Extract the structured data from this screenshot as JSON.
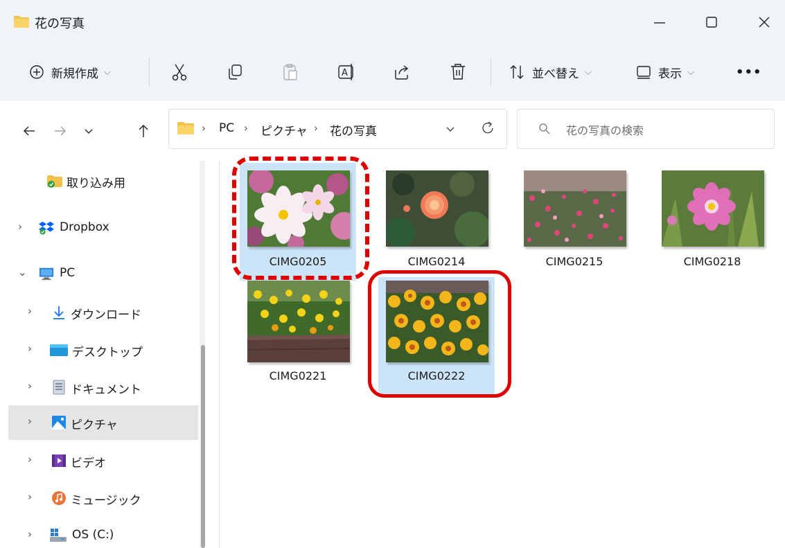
{
  "window": {
    "title": "花の写真",
    "controls": {
      "minimize": "minimize-icon",
      "maximize": "maximize-icon",
      "close": "close-icon"
    }
  },
  "toolbar": {
    "new_label": "新規作成",
    "sort_label": "並べ替え",
    "view_label": "表示",
    "more_label": "•••"
  },
  "address": {
    "crumbs": [
      "PC",
      "ピクチャ",
      "花の写真"
    ],
    "search_placeholder": "花の写真の検索"
  },
  "sidebar": {
    "items": [
      {
        "label": "取り込み用",
        "icon": "folder-sync-icon"
      },
      {
        "label": "Dropbox",
        "icon": "dropbox-icon"
      },
      {
        "label": "PC",
        "icon": "pc-icon"
      },
      {
        "label": "ダウンロード",
        "icon": "download-icon"
      },
      {
        "label": "デスクトップ",
        "icon": "desktop-icon"
      },
      {
        "label": "ドキュメント",
        "icon": "documents-icon"
      },
      {
        "label": "ピクチャ",
        "icon": "pictures-icon"
      },
      {
        "label": "ビデオ",
        "icon": "videos-icon"
      },
      {
        "label": "ミュージック",
        "icon": "music-icon"
      },
      {
        "label": "OS (C:)",
        "icon": "drive-icon"
      }
    ]
  },
  "files": [
    {
      "name": "CIMG0205",
      "selected": true
    },
    {
      "name": "CIMG0214",
      "selected": false
    },
    {
      "name": "CIMG0215",
      "selected": false
    },
    {
      "name": "CIMG0218",
      "selected": false
    },
    {
      "name": "CIMG0221",
      "selected": false
    },
    {
      "name": "CIMG0222",
      "selected": true
    }
  ],
  "colors": {
    "selection": "#cce4f7",
    "annotation": "#dd0000",
    "chrome": "#eff4f9"
  }
}
